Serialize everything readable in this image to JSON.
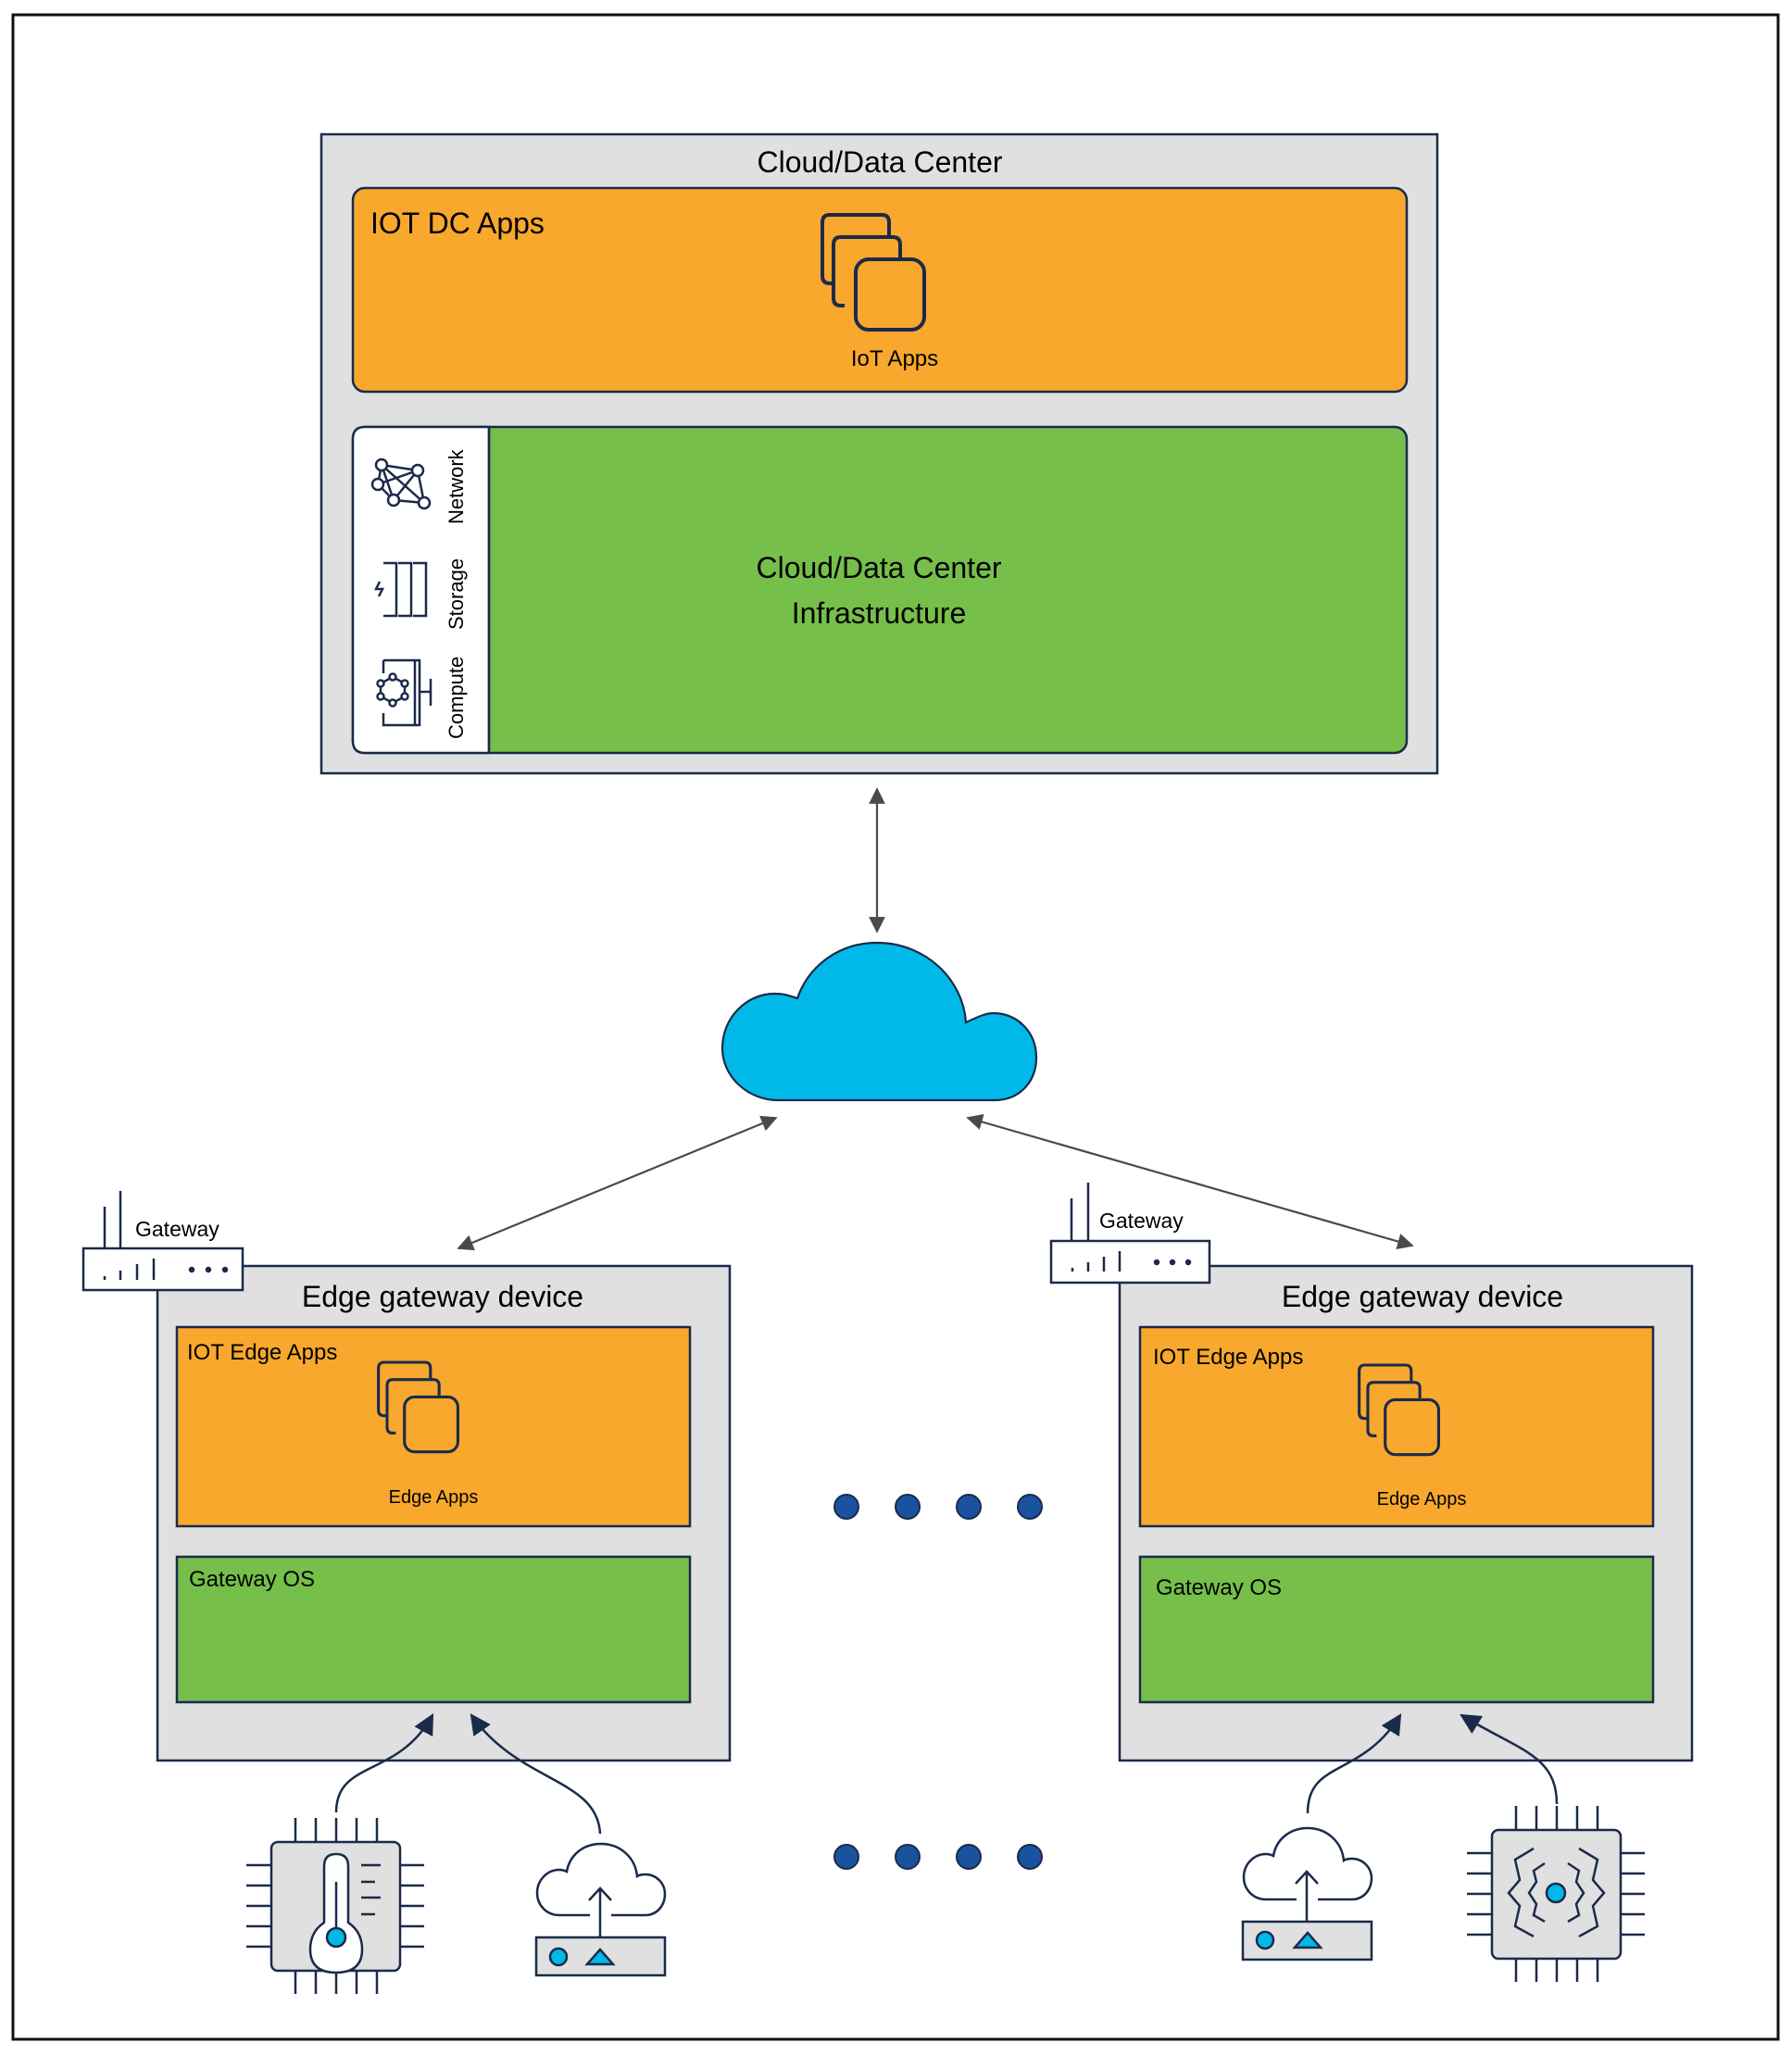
{
  "cloud_dc": {
    "title": "Cloud/Data Center",
    "apps_panel": {
      "title": "IOT DC Apps",
      "icon": "stacked-apps-icon",
      "icon_label": "IoT Apps"
    },
    "infrastructure_panel": {
      "title_line1": "Cloud/Data Center",
      "title_line2": "Infrastructure",
      "sidebar": [
        {
          "icon": "network-icon",
          "label": "Network"
        },
        {
          "icon": "storage-icon",
          "label": "Storage"
        },
        {
          "icon": "compute-icon",
          "label": "Compute"
        }
      ]
    }
  },
  "internet_cloud": {
    "icon": "cloud-icon"
  },
  "edge_devices": [
    {
      "gateway_label": "Gateway",
      "title": "Edge gateway device",
      "apps_title": "IOT Edge Apps",
      "apps_icon_label": "Edge Apps",
      "os_title": "Gateway OS",
      "sensors": [
        {
          "icon": "temperature-sensor-chip-icon"
        },
        {
          "icon": "cloud-upload-device-icon"
        }
      ]
    },
    {
      "gateway_label": "Gateway",
      "title": "Edge gateway device",
      "apps_title": "IOT Edge Apps",
      "apps_icon_label": "Edge Apps",
      "os_title": "Gateway OS",
      "sensors": [
        {
          "icon": "cloud-upload-device-icon"
        },
        {
          "icon": "vibration-sensor-chip-icon"
        }
      ]
    }
  ],
  "ellipsis_rows": 2,
  "colors": {
    "frame_gray": "#e0e0e0",
    "apps_orange": "#f7a82d",
    "infra_green": "#76bf4a",
    "cloud_blue": "#00b9e8",
    "outline_navy": "#1b2a4a",
    "dot_blue": "#1a52a0",
    "arrow_gray": "#4a4a4a"
  }
}
